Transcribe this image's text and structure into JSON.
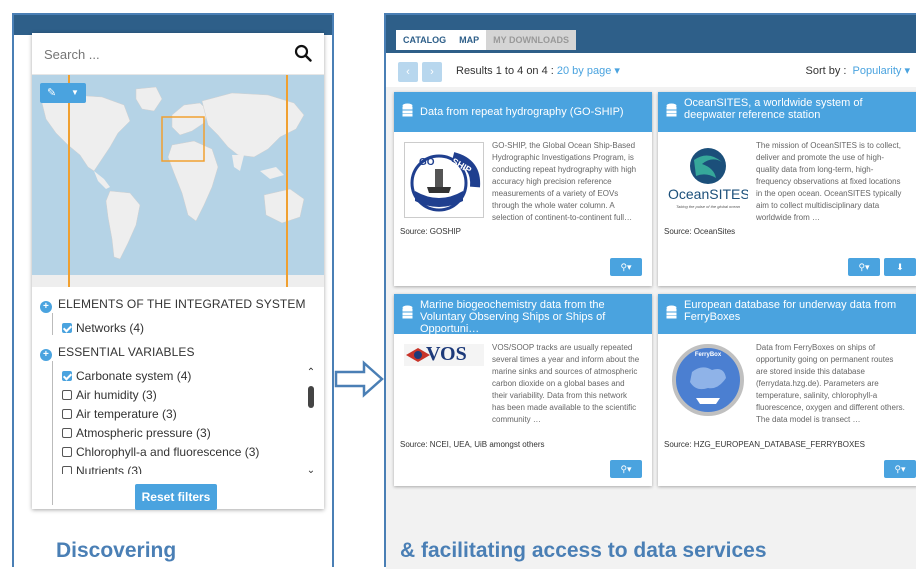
{
  "left": {
    "search_placeholder": "Search ...",
    "sections": [
      {
        "label": "ELEMENTS OF THE INTEGRATED SYSTEM",
        "items": [
          {
            "label": "Networks (4)",
            "checked": true
          }
        ]
      },
      {
        "label": "ESSENTIAL VARIABLES",
        "items": [
          {
            "label": "Carbonate system (4)",
            "checked": true
          },
          {
            "label": "Air humidity (3)",
            "checked": false
          },
          {
            "label": "Air temperature (3)",
            "checked": false
          },
          {
            "label": "Atmospheric pressure (3)",
            "checked": false
          },
          {
            "label": "Chlorophyll-a and fluorescence (3)",
            "checked": false
          },
          {
            "label": "Nutrients (3)",
            "checked": false
          }
        ]
      }
    ],
    "reset_label": "Reset filters",
    "caption": "Discovering"
  },
  "right": {
    "tabs": [
      {
        "label": "CATALOG",
        "state": "active"
      },
      {
        "label": "MAP",
        "state": "active"
      },
      {
        "label": "MY DOWNLOADS",
        "state": "disabled"
      }
    ],
    "prev_label": "‹",
    "next_label": "›",
    "results_prefix": "Results 1 to 4 on 4 : ",
    "results_per_page": "20 by page ▾",
    "sort_label": "Sort by :",
    "sort_value": "Popularity ▾",
    "cards": [
      {
        "title": "Data from repeat hydrography (GO-SHIP)",
        "logo": "GO-SHIP",
        "description": "GO-SHIP, the Global Ocean Ship-Based Hydrographic Investigations Program, is conducting repeat hydrography with high accuracy high precision reference measurements of a variety of EOVs through the whole water column. A selection of continent-to-continent full…",
        "source": "Source: GOSHIP"
      },
      {
        "title": "OceanSITES, a worldwide system of deepwater reference station",
        "logo": "OceanSITES",
        "logo_tagline": "Taking the pulse of the global ocean",
        "description": "The mission of OceanSITES is to collect, deliver and promote the use of high-quality data from long-term, high-frequency observations at fixed locations in the open ocean. OceanSITES typically aim to collect multidisciplinary data worldwide from …",
        "source": "Source: OceanSites"
      },
      {
        "title": "Marine biogeochemistry data from the Voluntary Observing Ships or Ships of Opportuni…",
        "logo": "VOS",
        "description": "VOS/SOOP tracks are usually repeated several times a year and inform about the marine sinks and sources of atmospheric carbon dioxide on a global bases and their variability. Data from this network has been made available to the scientific community …",
        "source": "Source: NCEI, UEA, UiB amongst others"
      },
      {
        "title": "European database for underway data from FerryBoxes",
        "logo": "FerryBox",
        "description": "Data from FerryBoxes on ships of opportunity going on permanent routes are stored inside this database (ferrydata.hzg.de). Parameters are temperature, salinity, chlorophyll-a fluorescence, oxygen and different others. The data model is transect …",
        "source": "Source: HZG_EUROPEAN_DATABASE_FERRYBOXES"
      }
    ],
    "caption": "& facilitating access to data services"
  },
  "colors": {
    "accent": "#4aa3df",
    "frame": "#4a7fb5",
    "header": "#2e5f89",
    "map_water": "#b5d3e6",
    "map_land": "#eeeeee",
    "bbox": "#f0a030"
  }
}
